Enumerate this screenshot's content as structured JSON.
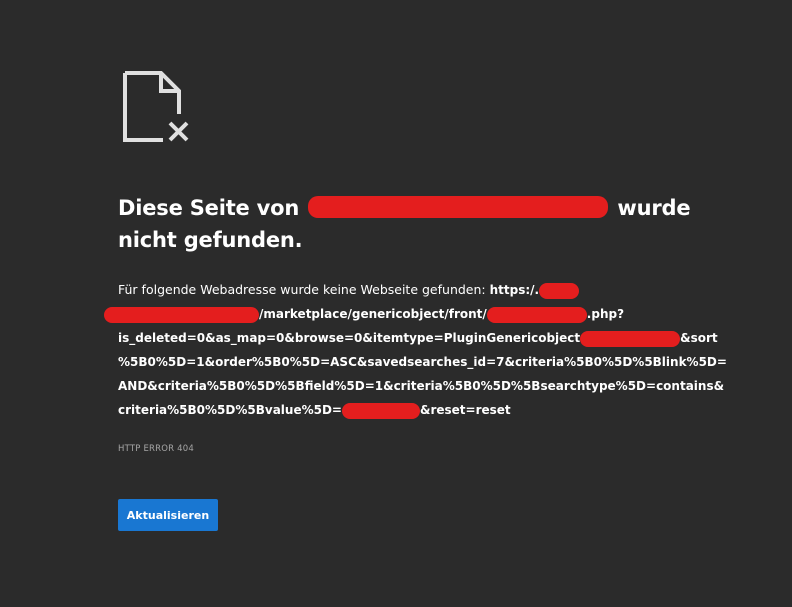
{
  "icon": "broken-document-icon",
  "title": {
    "part1": "Diese Seite von",
    "part2": "wurde",
    "part3": "nicht gefunden."
  },
  "description": {
    "intro": "Für folgende Webadresse wurde keine Webseite gefunden:",
    "url_start": "https:/.",
    "url_path1": "/marketplace/genericobject/front/",
    "url_path1_end": ".php?",
    "url_line3_a": "is_deleted=0&as_map=0&browse=0&itemtype=PluginGenericobject",
    "url_line3_b": "&sort",
    "url_line4": "%5B0%5D=1&order%5B0%5D=ASC&savedsearches_id=7&criteria%5B0%5D%5Blink%5D=",
    "url_line5": "AND&criteria%5B0%5D%5Bfield%5D=1&criteria%5B0%5D%5Bsearchtype%5D=contains&",
    "url_line6_a": "criteria%5B0%5D%5Bvalue%5D=",
    "url_line6_b": "&reset=reset"
  },
  "error_code": "HTTP ERROR 404",
  "reload_button": "Aktualisieren",
  "colors": {
    "background": "#2b2b2b",
    "redaction": "#e41e1e",
    "button": "#1977d2"
  }
}
